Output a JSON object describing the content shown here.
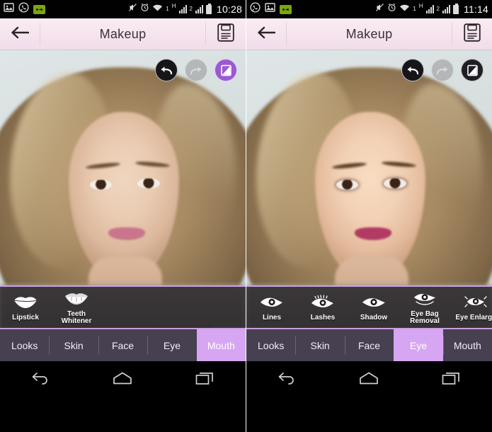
{
  "app": {
    "title": "Makeup",
    "back_icon": "back-arrow-icon",
    "save_icon": "save-floppy-disk-icon",
    "accent_color": "#d7a6f2",
    "titlebar_color": "#f6e4ef",
    "tabbar_color": "#474050"
  },
  "panels": [
    {
      "id": "before",
      "statusbar": {
        "time": "10:28",
        "left_icons": [
          "gallery-icon",
          "whatsapp-icon",
          "voicemail-icon"
        ],
        "right_icons": [
          "mute-icon",
          "alarm-icon",
          "wifi-icon",
          "hspa-icon",
          "signal-1-icon",
          "signal-2-icon",
          "battery-icon"
        ],
        "wifi_label": "1",
        "network_label": "H",
        "sim_label": "2"
      },
      "actions": [
        {
          "name": "undo-button",
          "icon": "undo-arrow-icon",
          "state": "enabled"
        },
        {
          "name": "redo-button",
          "icon": "redo-arrow-icon",
          "state": "disabled"
        },
        {
          "name": "compare-button",
          "icon": "compare-split-icon",
          "state": "active"
        }
      ],
      "tools": [
        {
          "label": "Lipstick",
          "label2": "",
          "icon": "lips-icon"
        },
        {
          "label": "Teeth",
          "label2": "Whitener",
          "icon": "teeth-smile-icon"
        }
      ],
      "tabs": [
        {
          "label": "Looks",
          "selected": false
        },
        {
          "label": "Skin",
          "selected": false
        },
        {
          "label": "Face",
          "selected": false
        },
        {
          "label": "Eye",
          "selected": false
        },
        {
          "label": "Mouth",
          "selected": true
        }
      ],
      "photo": {
        "lip_color": "#c9758c",
        "subject": "woman-portrait-before-makeup"
      }
    },
    {
      "id": "after",
      "statusbar": {
        "time": "11:14",
        "left_icons": [
          "whatsapp-icon",
          "gallery-icon",
          "voicemail-icon"
        ],
        "right_icons": [
          "mute-icon",
          "alarm-icon",
          "wifi-icon",
          "hspa-icon",
          "signal-1-icon",
          "signal-2-icon",
          "battery-icon"
        ],
        "wifi_label": "1",
        "network_label": "H",
        "sim_label": "2"
      },
      "actions": [
        {
          "name": "undo-button",
          "icon": "undo-arrow-icon",
          "state": "enabled"
        },
        {
          "name": "redo-button",
          "icon": "redo-arrow-icon",
          "state": "disabled"
        },
        {
          "name": "compare-button",
          "icon": "compare-split-icon",
          "state": "inactive"
        }
      ],
      "tools": [
        {
          "label": "Lines",
          "label2": "",
          "icon": "eye-liner-icon"
        },
        {
          "label": "Lashes",
          "label2": "",
          "icon": "eye-lashes-icon"
        },
        {
          "label": "Shadow",
          "label2": "",
          "icon": "eye-shadow-icon"
        },
        {
          "label": "Eye Bag",
          "label2": "Removal",
          "icon": "eye-bag-icon"
        },
        {
          "label": "Eye Enlarge",
          "label2": "",
          "icon": "eye-enlarge-icon"
        }
      ],
      "tabs": [
        {
          "label": "Looks",
          "selected": false
        },
        {
          "label": "Skin",
          "selected": false
        },
        {
          "label": "Face",
          "selected": false
        },
        {
          "label": "Eye",
          "selected": true
        },
        {
          "label": "Mouth",
          "selected": false
        }
      ],
      "photo": {
        "lip_color": "#b23b64",
        "subject": "woman-portrait-after-makeup"
      }
    }
  ],
  "navbar": {
    "back_label": "back-nav-icon",
    "home_label": "home-nav-icon",
    "recents_label": "recents-nav-icon"
  }
}
